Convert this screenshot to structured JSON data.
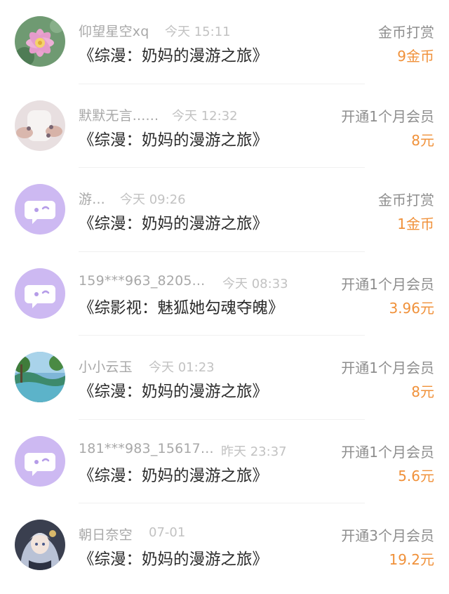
{
  "records": [
    {
      "name": "仰望星空xq",
      "time": "今天 15:11",
      "title": "《综漫：奶妈的漫游之旅》",
      "action": "金币打赏",
      "amount": "9金币",
      "avatar": "lotus-flower-avatar"
    },
    {
      "name": "默默无言......",
      "time": "今天 12:32",
      "title": "《综漫：奶妈的漫游之旅》",
      "action": "开通1个月会员",
      "amount": "8元",
      "avatar": "photo-hands-avatar"
    },
    {
      "name": "游...",
      "time": "今天 09:26",
      "title": "《综漫：奶妈的漫游之旅》",
      "action": "金币打赏",
      "amount": "1金币",
      "avatar": "default-purple-avatar"
    },
    {
      "name": "159***963_8205...",
      "time": "今天 08:33",
      "title": "《综影视：魅狐她勾魂夺魄》",
      "action": "开通1个月会员",
      "amount": "3.96元",
      "avatar": "default-purple-avatar"
    },
    {
      "name": "小小云玉",
      "time": "今天 01:23",
      "title": "《综漫：奶妈的漫游之旅》",
      "action": "开通1个月会员",
      "amount": "8元",
      "avatar": "landscape-avatar"
    },
    {
      "name": "181***983_15617...",
      "time": "昨天 23:37",
      "title": "《综漫：奶妈的漫游之旅》",
      "action": "开通1个月会员",
      "amount": "5.6元",
      "avatar": "default-purple-avatar"
    },
    {
      "name": "朝日奈空",
      "time": "07-01",
      "title": "《综漫：奶妈的漫游之旅》",
      "action": "开通3个月会员",
      "amount": "19.2元",
      "avatar": "anime-girl-avatar"
    }
  ],
  "colors": {
    "amount": "#f0913a",
    "name": "#a8a8a8",
    "time": "#c2c2c2",
    "title": "#2b2b2b",
    "action": "#8e8e8e",
    "default_avatar": "#cdb9f2"
  }
}
